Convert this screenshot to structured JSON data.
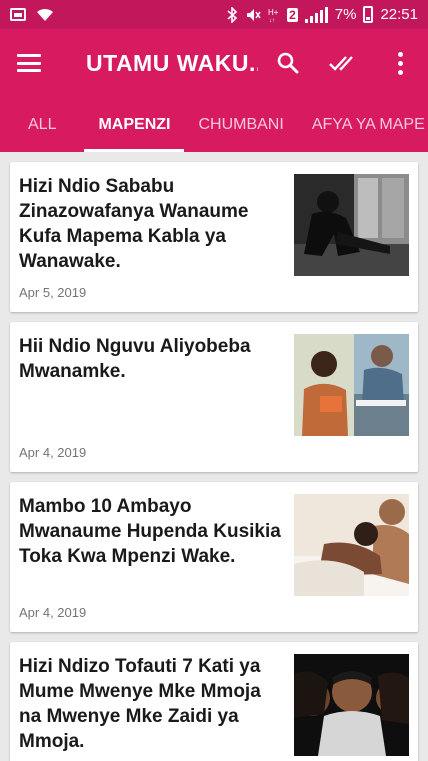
{
  "status_bar": {
    "sim_number": "2",
    "battery_percent": "7%",
    "time": "22:51"
  },
  "app_bar": {
    "title": "UTAMU WAKU..."
  },
  "tabs": [
    {
      "label": "ALL"
    },
    {
      "label": "MAPENZI"
    },
    {
      "label": "CHUMBANI"
    },
    {
      "label": "AFYA YA MAPE"
    }
  ],
  "articles": [
    {
      "title": "Hizi Ndio Sababu Zinazowafanya Wanaume Kufa Mapema Kabla ya Wanawake.",
      "date": "Apr 5, 2019"
    },
    {
      "title": "Hii Ndio Nguvu Aliyobeba Mwanamke.",
      "date": "Apr 4, 2019"
    },
    {
      "title": "Mambo 10 Ambayo Mwanaume Hupenda Kusikia Toka Kwa Mpenzi Wake.",
      "date": "Apr 4, 2019"
    },
    {
      "title": "Hizi Ndizo Tofauti 7 Kati ya Mume Mwenye Mke Mmoja na Mwenye Mke Zaidi ya Mmoja.",
      "date": ""
    }
  ]
}
